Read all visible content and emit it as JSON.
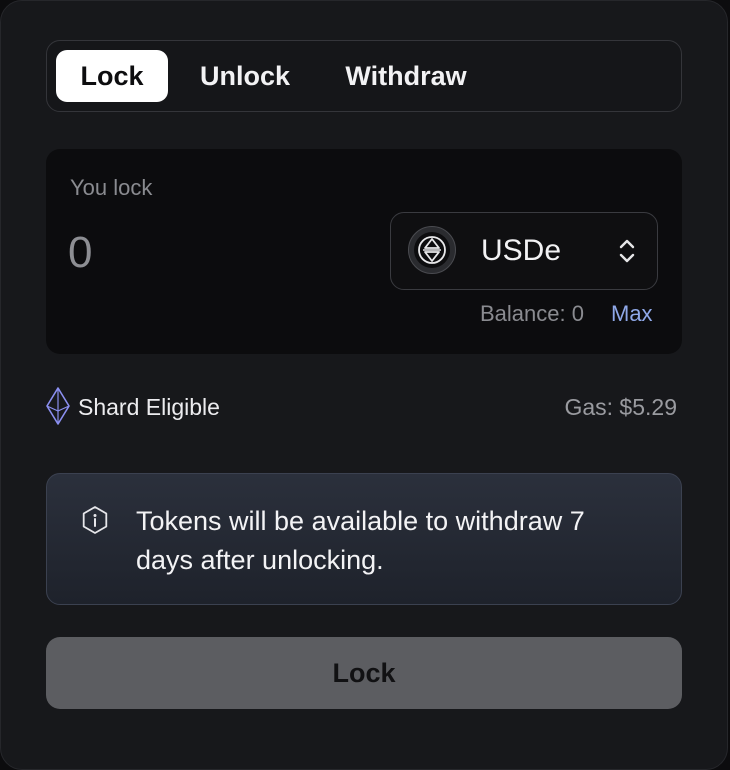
{
  "tabs": [
    {
      "label": "Lock",
      "active": true
    },
    {
      "label": "Unlock",
      "active": false
    },
    {
      "label": "Withdraw",
      "active": false
    }
  ],
  "lock_card": {
    "label": "You lock",
    "amount_placeholder": "0",
    "token": {
      "name": "USDe",
      "icon": "usde-token-icon"
    },
    "balance": "Balance: 0",
    "max_label": "Max"
  },
  "eligibility": {
    "label": "Shard Eligible",
    "icon": "shard-icon"
  },
  "gas": "Gas: $5.29",
  "info": {
    "icon": "info-icon",
    "text": "Tokens will be available to withdraw 7 days after unlocking."
  },
  "action_button": "Lock",
  "colors": {
    "background": "#17181b",
    "card": "#0c0c0e",
    "accent_link": "#8fa8e8",
    "shard": "#8b8ff0",
    "button_disabled": "#5c5d61"
  }
}
